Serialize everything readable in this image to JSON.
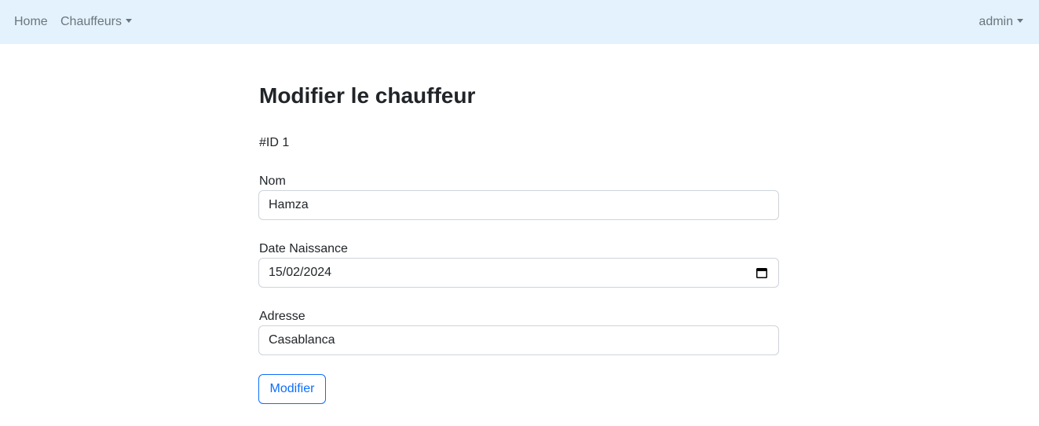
{
  "navbar": {
    "home_label": "Home",
    "chauffeurs_label": "Chauffeurs",
    "user_label": "admin",
    "background": "#e3f2fd"
  },
  "page": {
    "title": "Modifier le chauffeur",
    "id_label": "#ID 1"
  },
  "form": {
    "nom": {
      "label": "Nom",
      "value": "Hamza"
    },
    "date_naissance": {
      "label": "Date Naissance",
      "value": "15/02/2024",
      "icon": "calendar-icon"
    },
    "adresse": {
      "label": "Adresse",
      "value": "Casablanca"
    },
    "submit_label": "Modifier"
  },
  "colors": {
    "primary": "#0d6efd",
    "nav_text": "#6c757d",
    "border": "#ced4da"
  }
}
